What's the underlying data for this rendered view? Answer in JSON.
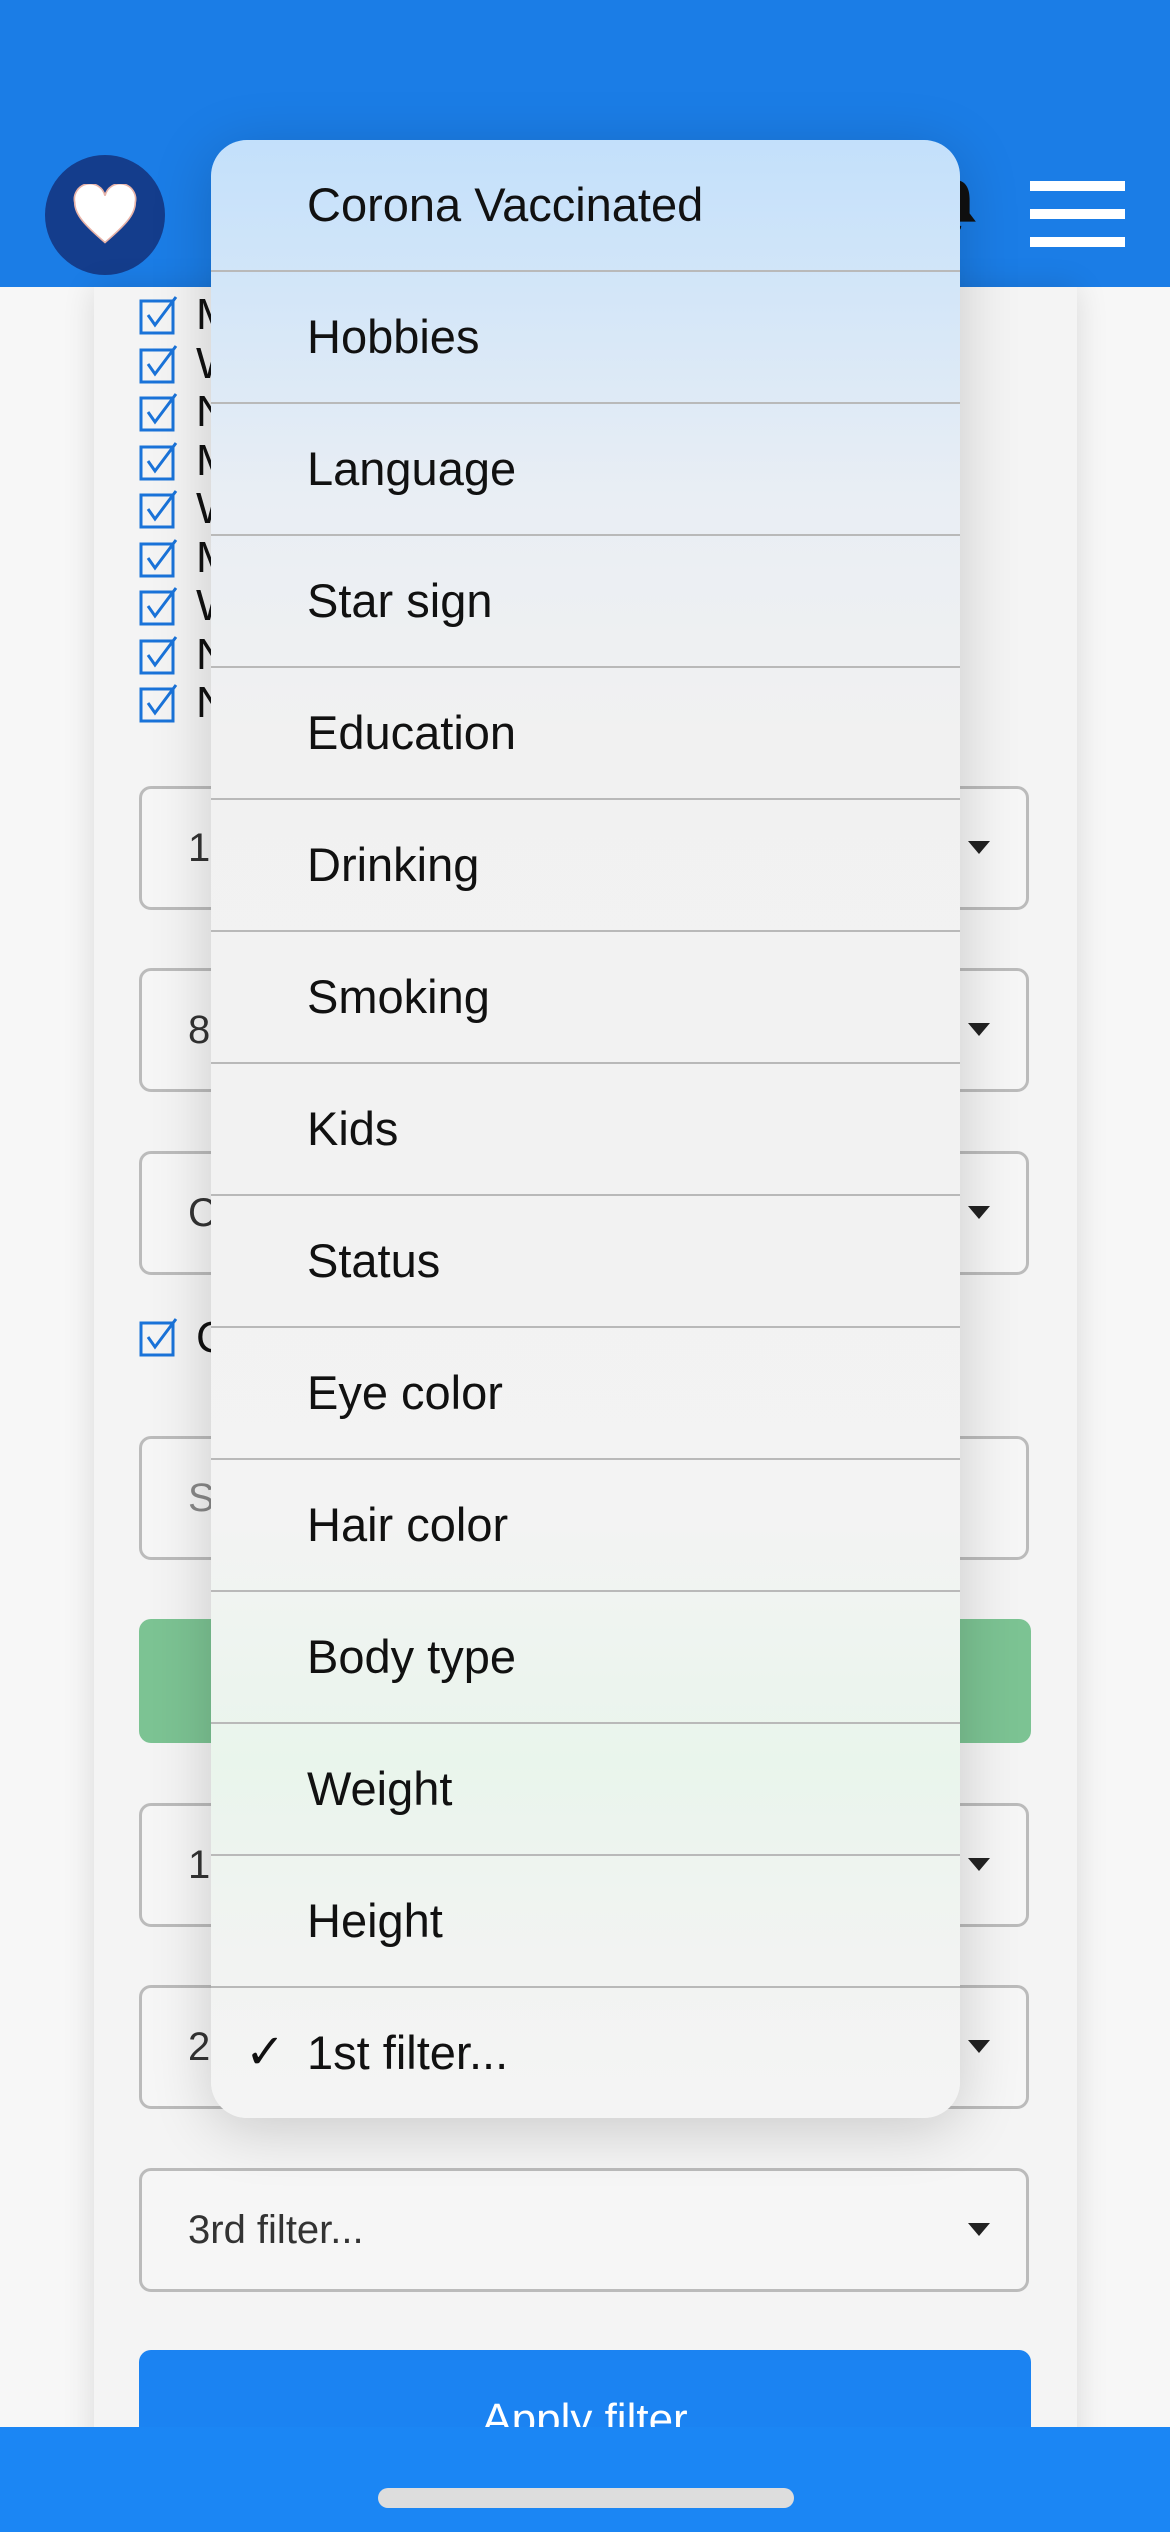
{
  "colors": {
    "header": "#1b7de6",
    "logo_bg": "#143d8c",
    "accent_button": "#1b83f2",
    "success_button": "#7cc393",
    "checkbox": "#1a73d9"
  },
  "header": {
    "logo_icon": "heart-icon",
    "bell_icon": "bell-icon",
    "menu_icon": "hamburger-icon"
  },
  "background_form": {
    "checkbox_labels": [
      "M",
      "W",
      "N",
      "M",
      "W",
      "M",
      "W",
      "N",
      "N"
    ],
    "selects_top": [
      "1",
      "8",
      "C"
    ],
    "option_checkbox_label": "C",
    "search_placeholder": "S",
    "filter_selects": [
      "1",
      "2",
      "3rd filter..."
    ],
    "apply_label": "Apply filter"
  },
  "dropdown": {
    "items": [
      "Corona Vaccinated",
      "Hobbies",
      "Language",
      "Star sign",
      "Education",
      "Drinking",
      "Smoking",
      "Kids",
      "Status",
      "Eye color",
      "Hair color",
      "Body type",
      "Weight",
      "Height",
      "1st filter..."
    ],
    "selected": "1st filter...",
    "check_mark": "✓"
  }
}
